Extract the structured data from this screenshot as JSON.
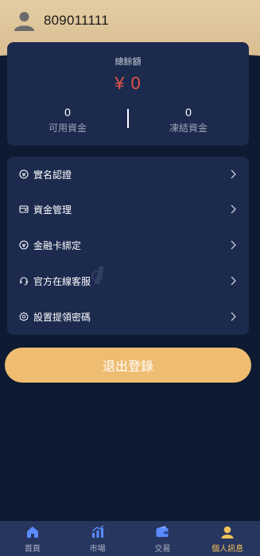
{
  "header": {
    "account": "809011111",
    "avatar_icon": "user-icon"
  },
  "balance": {
    "title": "總餘額",
    "amount": "¥ 0",
    "available_value": "0",
    "available_label": "可用資金",
    "frozen_value": "0",
    "frozen_label": "凍結資金"
  },
  "menu": {
    "items": [
      {
        "label": "實名認證",
        "icon": "verify-icon"
      },
      {
        "label": "資金管理",
        "icon": "wallet-icon"
      },
      {
        "label": "金融卡綁定",
        "icon": "card-icon"
      },
      {
        "label": "官方在線客服",
        "icon": "headset-icon"
      },
      {
        "label": "設置提領密碼",
        "icon": "settings-icon"
      }
    ]
  },
  "logout_label": "退出登錄",
  "tabs": [
    {
      "label": "首頁",
      "icon": "home-icon",
      "active": false
    },
    {
      "label": "市場",
      "icon": "market-icon",
      "active": false
    },
    {
      "label": "交易",
      "icon": "trade-icon",
      "active": false
    },
    {
      "label": "個人訊息",
      "icon": "profile-icon",
      "active": true
    }
  ],
  "colors": {
    "background": "#0e1a31",
    "card": "#1b2a4d",
    "header_gold": "#e4cda3",
    "amount_red": "#e25447",
    "button": "#efbd72",
    "tab_active": "#f4c35a",
    "tabbar": "#27365f"
  }
}
